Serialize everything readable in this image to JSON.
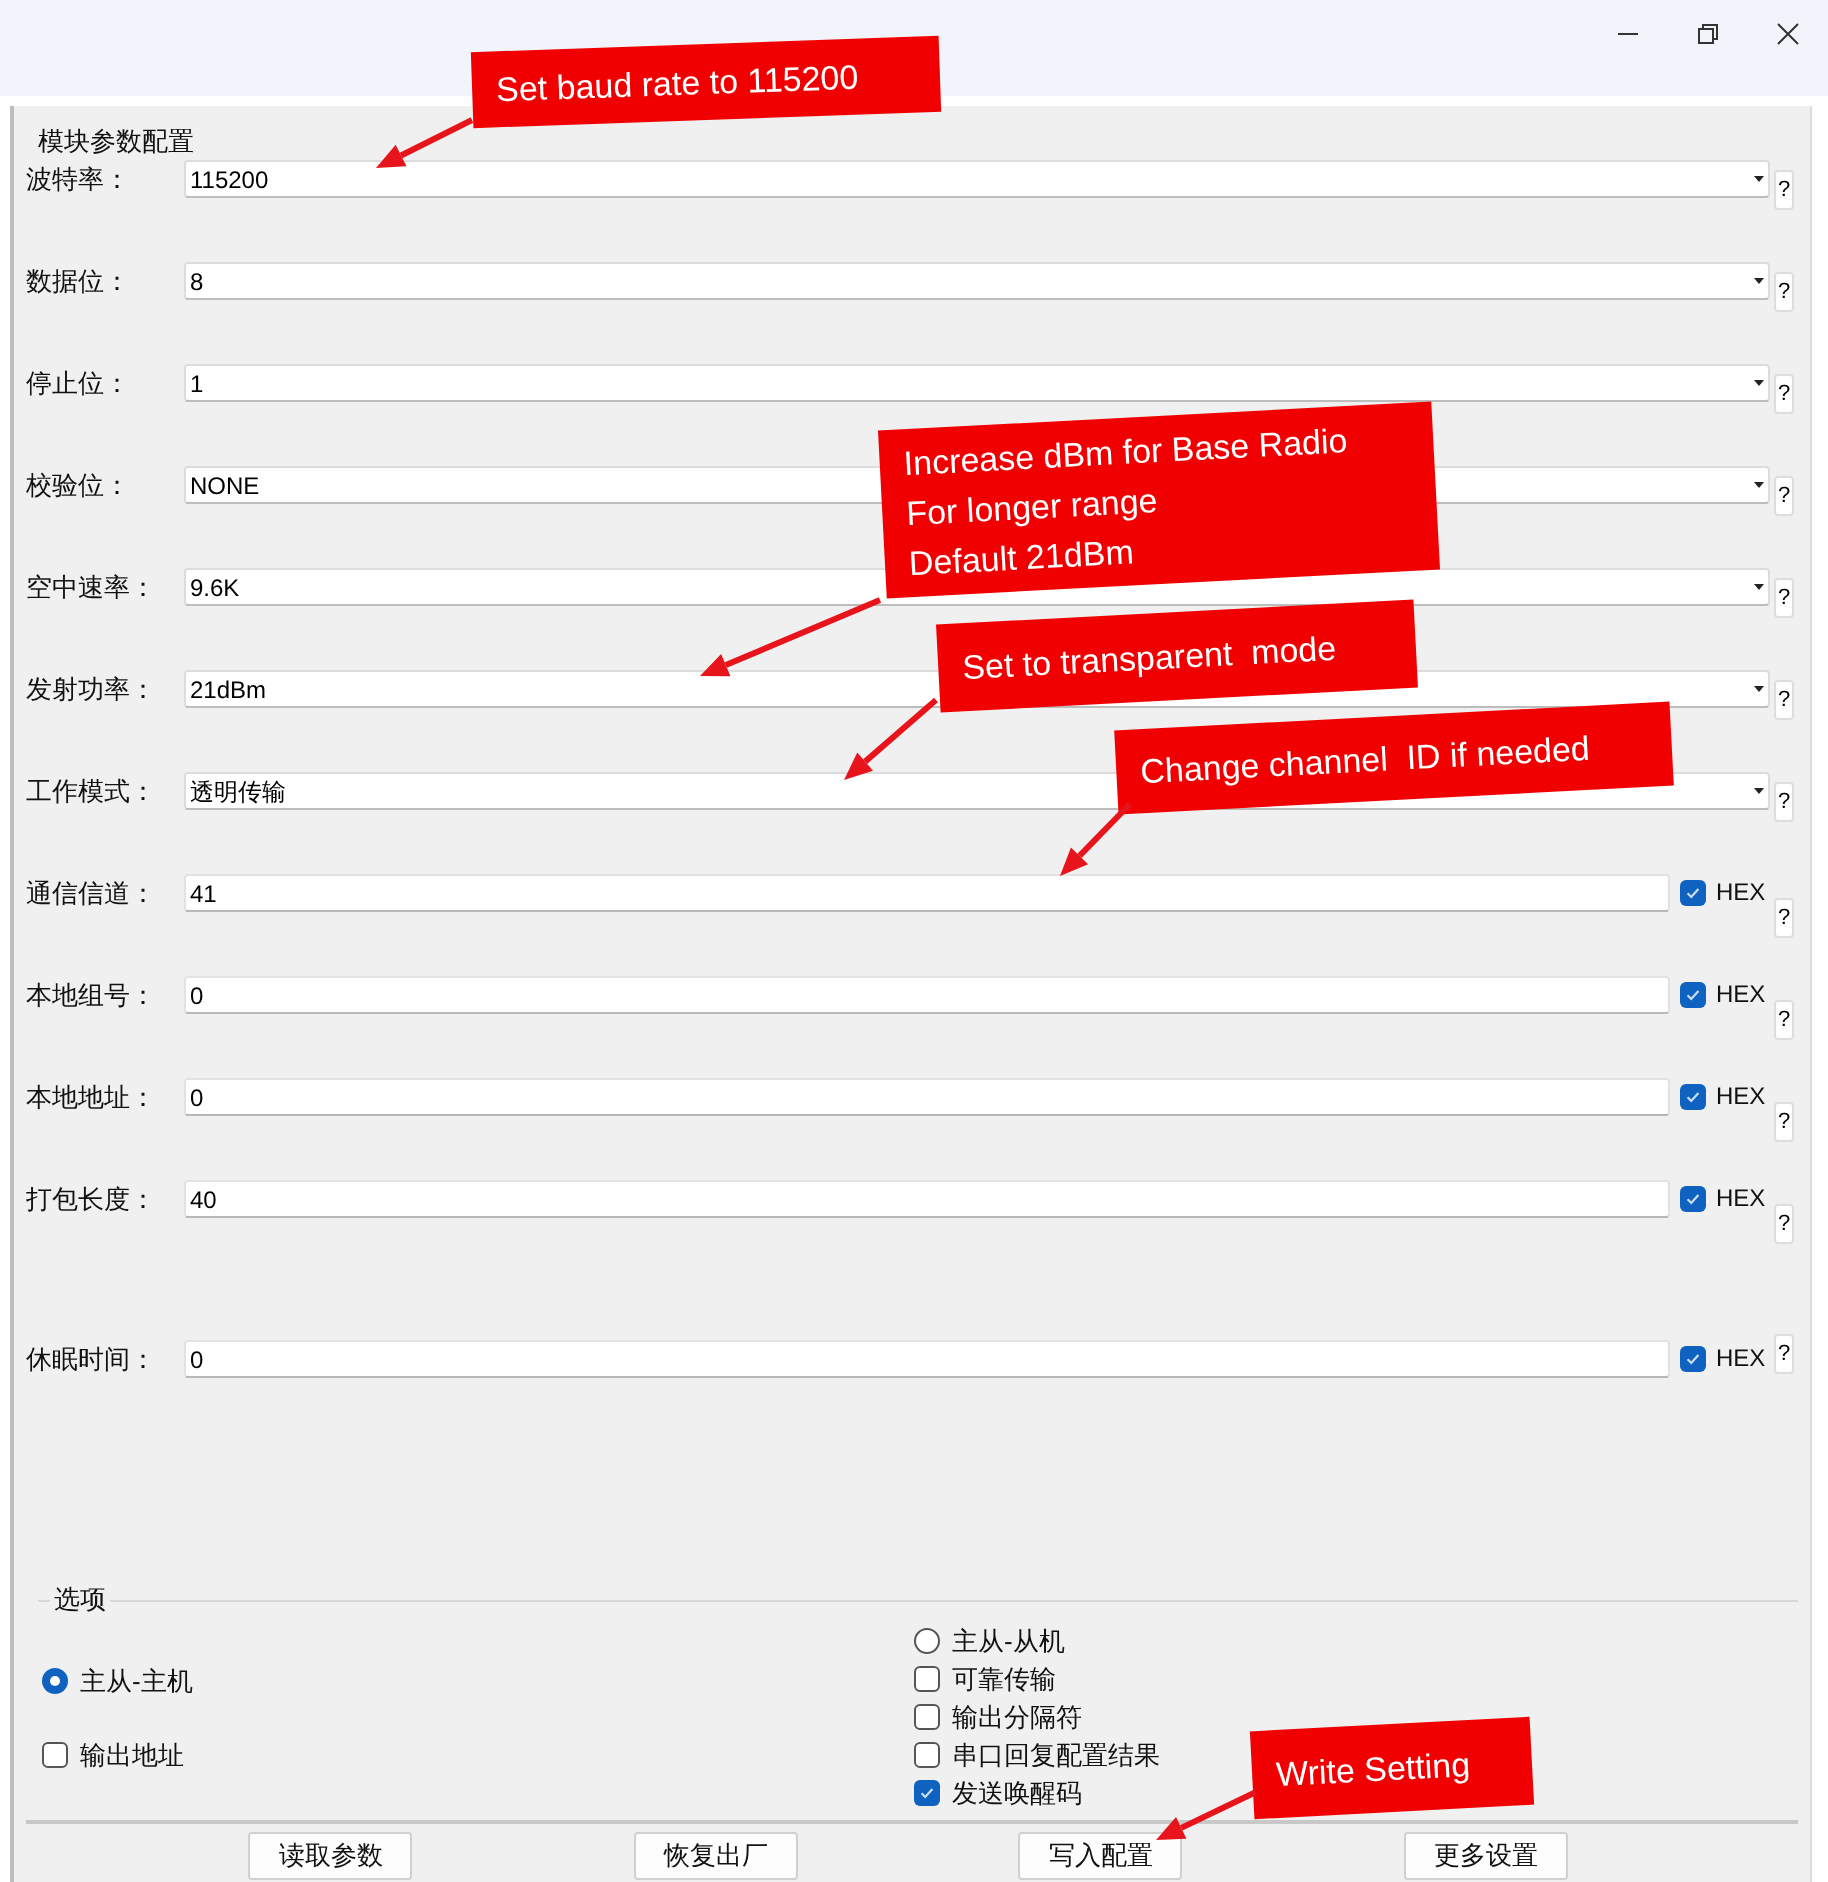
{
  "config_group": {
    "title": "模块参数配置",
    "fields": [
      {
        "kind": "select",
        "label": "波特率：",
        "value": "115200",
        "help": "?"
      },
      {
        "kind": "select",
        "label": "数据位：",
        "value": "8",
        "help": "?"
      },
      {
        "kind": "select",
        "label": "停止位：",
        "value": "1",
        "help": "?"
      },
      {
        "kind": "select",
        "label": "校验位：",
        "value": "NONE",
        "help": "?"
      },
      {
        "kind": "select",
        "label": "空中速率：",
        "value": "9.6K",
        "help": "?"
      },
      {
        "kind": "select",
        "label": "发射功率：",
        "value": "21dBm",
        "help": "?"
      },
      {
        "kind": "select",
        "label": "工作模式：",
        "value": "透明传输",
        "help": "?"
      },
      {
        "kind": "text",
        "label": "通信信道：",
        "value": "41",
        "hex_checked": true,
        "hex_label": "HEX",
        "help": "?"
      },
      {
        "kind": "text",
        "label": "本地组号：",
        "value": "0",
        "hex_checked": true,
        "hex_label": "HEX",
        "help": "?"
      },
      {
        "kind": "text",
        "label": "本地地址：",
        "value": "0",
        "hex_checked": true,
        "hex_label": "HEX",
        "help": "?"
      },
      {
        "kind": "text",
        "label": "打包长度：",
        "value": "40",
        "hex_checked": true,
        "hex_label": "HEX",
        "help": "?"
      },
      {
        "kind": "text",
        "label": "休眠时间：",
        "value": "0",
        "hex_checked": true,
        "hex_label": "HEX",
        "help": "?"
      }
    ]
  },
  "options_group": {
    "title": "选项",
    "left": [
      {
        "kind": "radio",
        "label": "主从-主机",
        "selected": true
      },
      {
        "kind": "checkbox",
        "label": "输出地址",
        "checked": false
      }
    ],
    "right": [
      {
        "kind": "radio",
        "label": "主从-从机",
        "selected": false
      },
      {
        "kind": "checkbox",
        "label": "可靠传输",
        "checked": false
      },
      {
        "kind": "checkbox",
        "label": "输出分隔符",
        "checked": false
      },
      {
        "kind": "checkbox",
        "label": "串口回复配置结果",
        "checked": false
      },
      {
        "kind": "checkbox",
        "label": "发送唤醒码",
        "checked": true
      }
    ]
  },
  "buttons": [
    "读取参数",
    "恢复出厂",
    "写入配置",
    "更多设置"
  ],
  "annotations": [
    {
      "lines": [
        "Set baud rate to 115200"
      ]
    },
    {
      "lines": [
        "Increase dBm for Base Radio",
        "For longer range",
        "Default 21dBm"
      ]
    },
    {
      "lines": [
        "Set to transparent  mode"
      ]
    },
    {
      "lines": [
        "Change channel  ID if needed"
      ]
    },
    {
      "lines": [
        "Write Setting"
      ]
    }
  ]
}
